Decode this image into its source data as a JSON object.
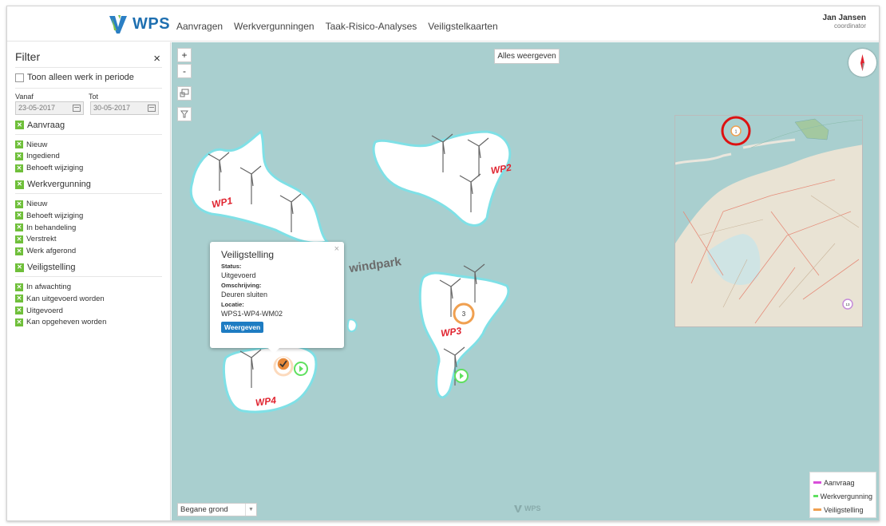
{
  "header": {
    "logo_text": "WPS",
    "nav": [
      "Aanvragen",
      "Werkvergunningen",
      "Taak-Risico-Analyses",
      "Veiligstelkaarten"
    ],
    "user_name": "Jan Jansen",
    "user_role": "coordinator"
  },
  "filter": {
    "title": "Filter",
    "close": "×",
    "only_period_label": "Toon alleen werk in periode",
    "from_label": "Vanaf",
    "to_label": "Tot",
    "from_value": "23-05-2017",
    "to_value": "30-05-2017",
    "sections": [
      {
        "title": "Aanvraag",
        "items": [
          "Nieuw",
          "Ingediend",
          "Behoeft wijziging"
        ]
      },
      {
        "title": "Werkvergunning",
        "items": [
          "Nieuw",
          "Behoeft wijziging",
          "In behandeling",
          "Verstrekt",
          "Werk afgerond"
        ]
      },
      {
        "title": "Veiligstelling",
        "items": [
          "In afwachting",
          "Kan uitgevoerd worden",
          "Uitgevoerd",
          "Kan opgeheven worden"
        ]
      }
    ],
    "check_mark": "✕"
  },
  "map": {
    "zoom_in": "+",
    "zoom_out": "-",
    "show_all": "Alles weergeven",
    "area_label": "windpark",
    "islands": [
      "WP1",
      "WP2",
      "WP3",
      "WP4"
    ],
    "cluster_count": "3",
    "minimap_cluster_count": "1",
    "minimap_cluster2_count": "13",
    "floor": "Begane grond",
    "watermark": "WPS"
  },
  "popup": {
    "title": "Veiligstelling",
    "close": "×",
    "status_label": "Status:",
    "status_value": "Uitgevoerd",
    "desc_label": "Omschrijving:",
    "desc_value": "Deuren sluiten",
    "location_label": "Locatie:",
    "location_value": "WPS1-WP4-WM02",
    "button": "Weergeven"
  },
  "legend": [
    {
      "label": "Aanvraag",
      "color": "#d94fd9"
    },
    {
      "label": "Werkvergunning",
      "color": "#5fe05f"
    },
    {
      "label": "Veiligstelling",
      "color": "#f0a050"
    }
  ],
  "colors": {
    "sea": "#a9cfcf",
    "island_edge": "#7fe0e6",
    "wp_label": "#e0222e",
    "brand": "#1e6fb0",
    "check_green": "#6fbf3a"
  }
}
